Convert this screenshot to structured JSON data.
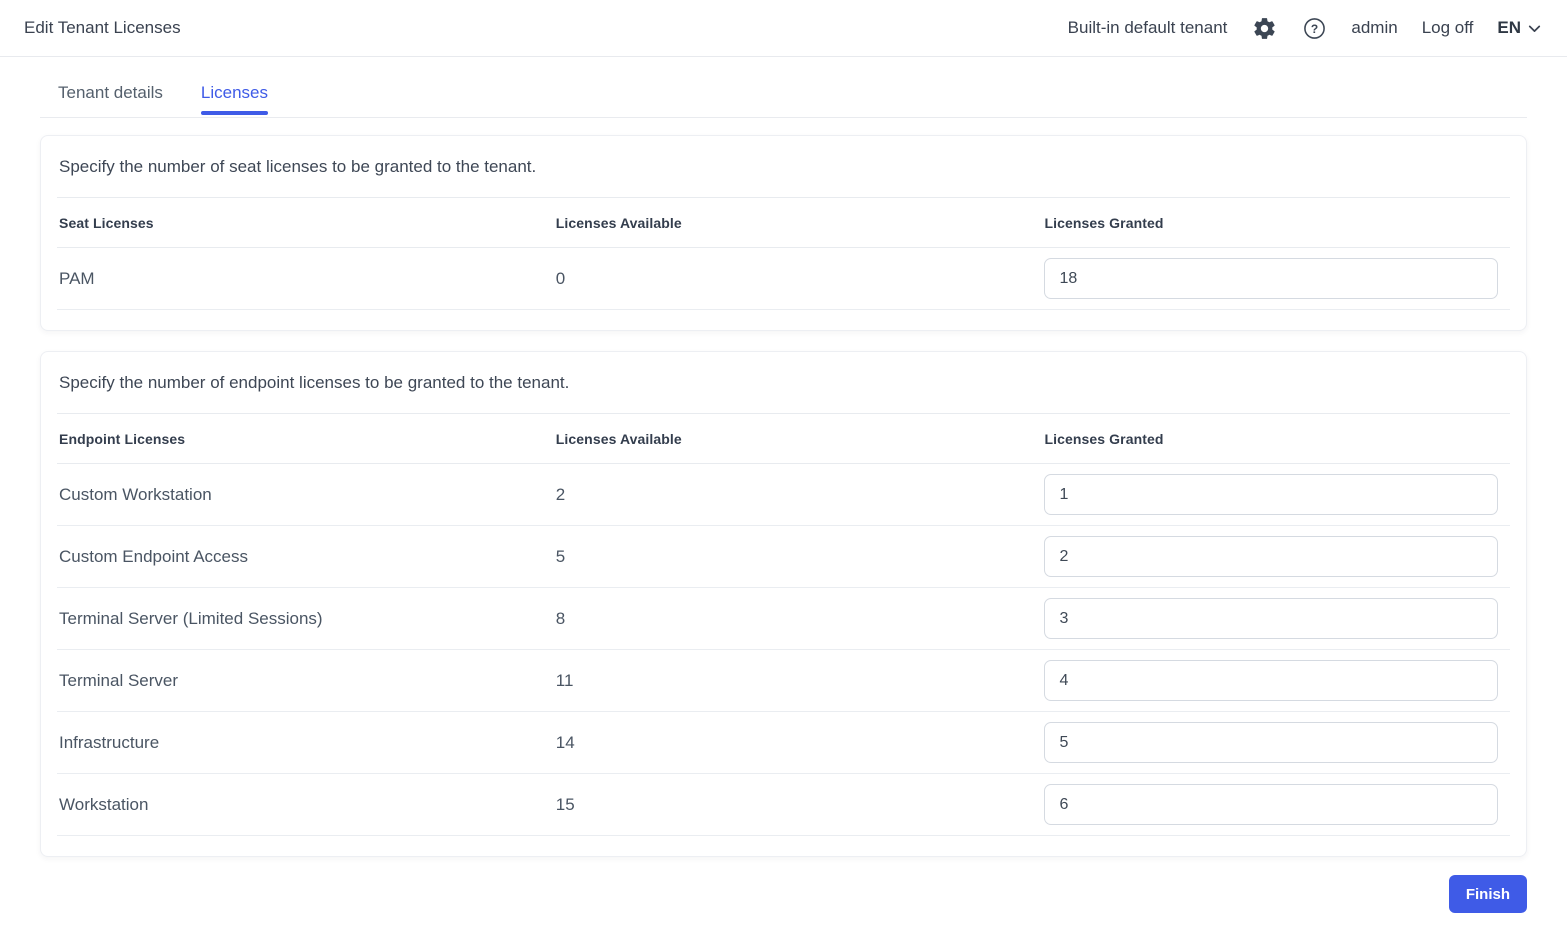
{
  "header": {
    "title": "Edit Tenant Licenses",
    "tenant_label": "Built-in default tenant",
    "username": "admin",
    "logoff_label": "Log off",
    "language": "EN"
  },
  "tabs": [
    {
      "label": "Tenant details",
      "active": false
    },
    {
      "label": "Licenses",
      "active": true
    }
  ],
  "seat_section": {
    "description": "Specify the number of seat licenses to be granted to the tenant.",
    "columns": [
      "Seat Licenses",
      "Licenses Available",
      "Licenses Granted"
    ],
    "rows": [
      {
        "name": "PAM",
        "available": "0",
        "granted": "18"
      }
    ]
  },
  "endpoint_section": {
    "description": "Specify the number of endpoint licenses to be granted to the tenant.",
    "columns": [
      "Endpoint Licenses",
      "Licenses Available",
      "Licenses Granted"
    ],
    "rows": [
      {
        "name": "Custom Workstation",
        "available": "2",
        "granted": "1"
      },
      {
        "name": "Custom Endpoint Access",
        "available": "5",
        "granted": "2"
      },
      {
        "name": "Terminal Server (Limited Sessions)",
        "available": "8",
        "granted": "3"
      },
      {
        "name": "Terminal Server",
        "available": "11",
        "granted": "4"
      },
      {
        "name": "Infrastructure",
        "available": "14",
        "granted": "5"
      },
      {
        "name": "Workstation",
        "available": "15",
        "granted": "6"
      }
    ]
  },
  "footer": {
    "finish_label": "Finish"
  },
  "icons": {
    "settings": "settings-gear",
    "help": "help-question",
    "language_chevron": "chevron-down"
  },
  "colors": {
    "accent": "#3f5be7",
    "text_dark": "#3a4250",
    "text_row": "#4a5563",
    "divider": "#e8ebef",
    "input_border": "#d5dae1"
  }
}
